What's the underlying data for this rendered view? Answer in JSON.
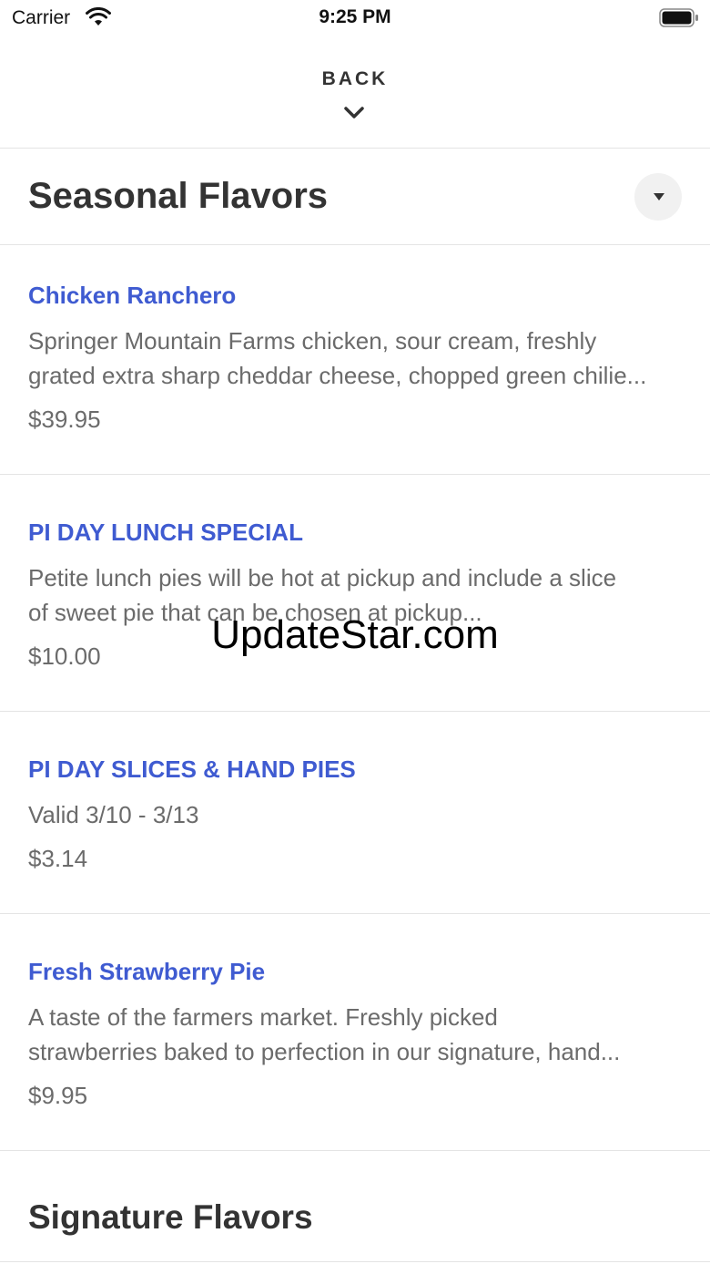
{
  "status_bar": {
    "carrier": "Carrier",
    "time": "9:25 PM"
  },
  "nav": {
    "back_label": "BACK"
  },
  "sections": [
    {
      "title": "Seasonal Flavors",
      "items": [
        {
          "name": "Chicken Ranchero",
          "description_line1": "Springer Mountain Farms chicken, sour cream, freshly",
          "description_line2": "grated extra sharp cheddar cheese, chopped green chilie...",
          "price": "$39.95"
        },
        {
          "name": "PI DAY LUNCH SPECIAL",
          "description_line1": "Petite lunch pies will be hot at pickup and include a slice",
          "description_line2": "of sweet pie that can be chosen at pickup...",
          "price": "$10.00"
        },
        {
          "name": "PI DAY SLICES & HAND PIES",
          "description_line1": "Valid 3/10 - 3/13",
          "description_line2": "",
          "price": "$3.14"
        },
        {
          "name": "Fresh Strawberry Pie",
          "description_line1": "A taste of the farmers market.  Freshly picked",
          "description_line2": "strawberries baked to perfection in our signature, hand...",
          "price": "$9.95"
        }
      ]
    },
    {
      "title": "Signature Flavors"
    }
  ],
  "watermark": "UpdateStar.com",
  "colors": {
    "item_name": "#3f5bd1",
    "description": "#6b6b6b",
    "divider": "#e4e4e4"
  }
}
